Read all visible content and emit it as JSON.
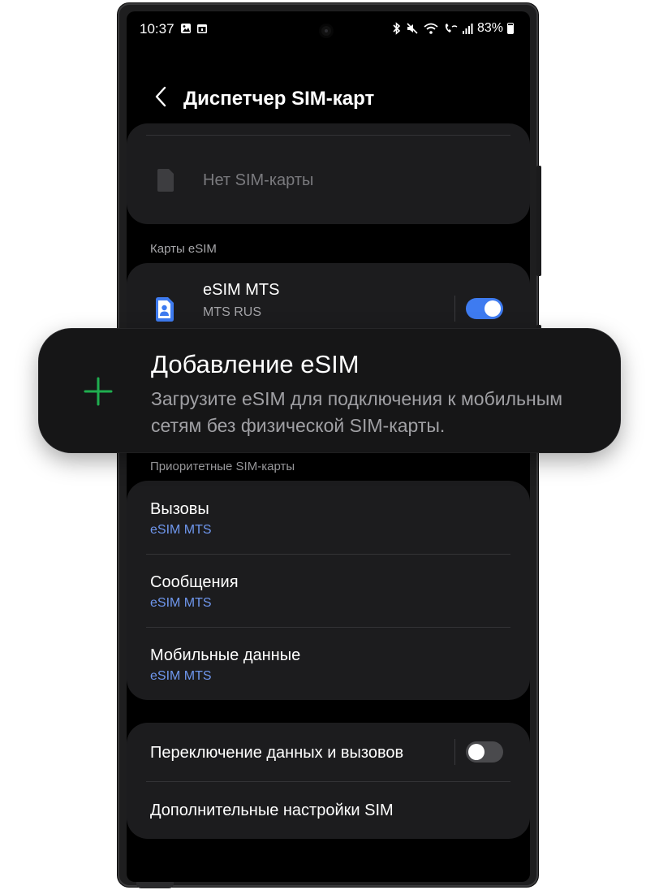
{
  "status_bar": {
    "time": "10:37",
    "battery": "83%"
  },
  "header": {
    "title": "Диспетчер SIM-карт"
  },
  "sim_slot": {
    "label": "Нет SIM-карты"
  },
  "esim_section": {
    "label": "Карты eSIM",
    "items": [
      {
        "name": "eSIM MTS",
        "operator": "MTS RUS",
        "enabled": true
      }
    ]
  },
  "add_esim": {
    "title": "Добавление eSIM",
    "description": "Загрузите eSIM для подключения к мобильным сетям без физической SIM-карты."
  },
  "priority_section": {
    "label": "Приоритетные SIM-карты",
    "items": [
      {
        "title": "Вызовы",
        "value": "eSIM MTS"
      },
      {
        "title": "Сообщения",
        "value": "eSIM MTS"
      },
      {
        "title": "Мобильные данные",
        "value": "eSIM MTS"
      }
    ]
  },
  "extra": {
    "data_switch_label": "Переключение данных и вызовов",
    "data_switch_enabled": false,
    "more_settings_label": "Дополнительные настройки SIM"
  },
  "colors": {
    "accent": "#3e7bf0",
    "accent_text": "#6f97ee",
    "plus_green": "#1fae4f",
    "card": "#1c1c1e"
  }
}
